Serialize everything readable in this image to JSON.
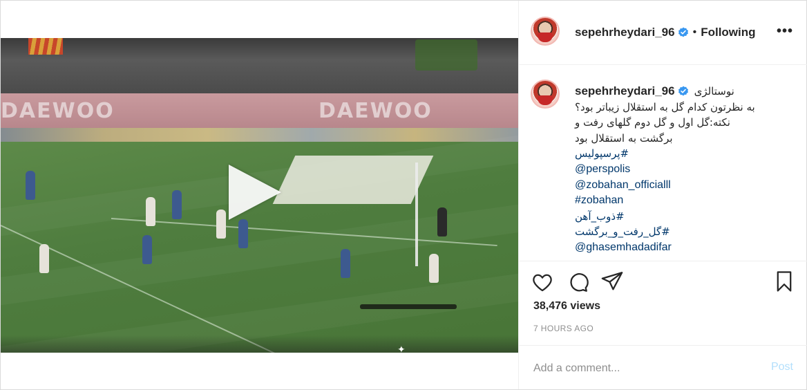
{
  "header": {
    "username": "sepehrheydari_96",
    "separator": "•",
    "follow_status": "Following",
    "more_label": "•••"
  },
  "caption": {
    "username": "sepehrheydari_96",
    "first_line": "نوستالژی",
    "lines": [
      "به نظرتون کدام گل به استقلال زیباتر بود؟",
      "نکته:گل اول و گل دوم گلهای رفت و",
      "برگشت به استقلال بود"
    ],
    "tags": [
      "#پرسپولیس",
      "@perspolis",
      "@zobahan_officialll",
      "#zobahan",
      "#ذوب_آهن",
      "#گل_رفت_و_برگشت",
      "@ghasemhadadifar"
    ]
  },
  "stats": {
    "views": "38,476 views",
    "time": "7 HOURS AGO"
  },
  "comment": {
    "placeholder": "Add a comment...",
    "post_label": "Post"
  },
  "colors": {
    "link": "#00376b",
    "verified": "#3897f0",
    "post_disabled": "#b2dffc",
    "muted": "#8e8e8e"
  },
  "icons": [
    "play-icon",
    "verified-badge-icon",
    "more-options-icon",
    "heart-icon",
    "comment-icon",
    "share-icon",
    "bookmark-icon"
  ]
}
